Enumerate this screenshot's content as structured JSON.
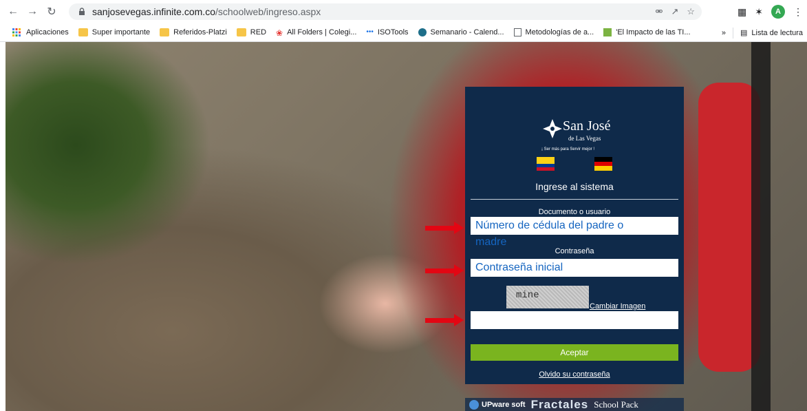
{
  "browser": {
    "url_host": "sanjosevegas.infinite.com.co",
    "url_path": "/schoolweb/ingreso.aspx",
    "avatar_letter": "A"
  },
  "bookmarks": {
    "apps_label": "Aplicaciones",
    "items": [
      {
        "label": "Super importante",
        "icon": "folder-icon"
      },
      {
        "label": "Referidos-Platzi",
        "icon": "folder-icon"
      },
      {
        "label": "RED",
        "icon": "folder-icon"
      },
      {
        "label": "All Folders | Colegi...",
        "icon": "colegio-icon"
      },
      {
        "label": "ISOTools",
        "icon": "isotools-icon"
      },
      {
        "label": "Semanario - Calend...",
        "icon": "semanario-icon"
      },
      {
        "label": "Metodologías de a...",
        "icon": "document-icon"
      },
      {
        "label": "'El Impacto de las TI...",
        "icon": "green-app-icon"
      }
    ],
    "more": "»",
    "reading_list": "Lista de lectura"
  },
  "login": {
    "logo_name": "San José",
    "logo_sub": "de Las Vegas",
    "logo_tag": "¡ Ser más para Servir mejor !",
    "title": "Ingrese al sistema",
    "user_label": "Documento o usuario",
    "user_value": "Número de cédula del padre o",
    "user_value_overflow": "madre",
    "password_label": "Contraseña",
    "password_value": "Contraseña inicial",
    "captcha_text": "mine",
    "change_image": "Cambiar Imagen",
    "captcha_value": "",
    "submit": "Aceptar",
    "forgot": "Olvido su contraseña"
  },
  "footer": {
    "brand1": "UPware soft",
    "brand2": "Fractales",
    "brand3": "School Pack"
  },
  "colors": {
    "panel": "#0f2a4a",
    "button": "#7ab41f",
    "field_text": "#1565c0",
    "arrow": "#e30613"
  }
}
